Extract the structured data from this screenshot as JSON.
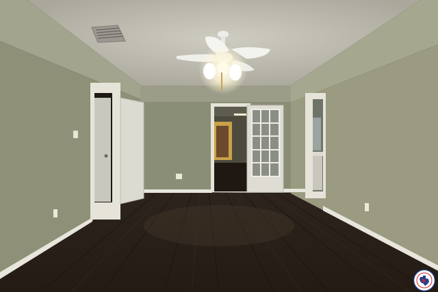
{
  "scene": {
    "description_tag": "interior-room-photo",
    "colors": {
      "ceiling": "#b9b7ab",
      "left_wall": "#8f9177",
      "right_wall": "#9a9b81",
      "back_wall": "#8a8d76",
      "floor": "#2b211a",
      "trim": "#e8e6dc",
      "door": "#d9d8cf",
      "light_glow": "#fff7d8"
    }
  },
  "logo": {
    "icon": "texas-realtor-seal-icon",
    "colors": {
      "ring": "#1f3f8f",
      "accent": "#c8242f",
      "fill": "#ffffff"
    }
  }
}
